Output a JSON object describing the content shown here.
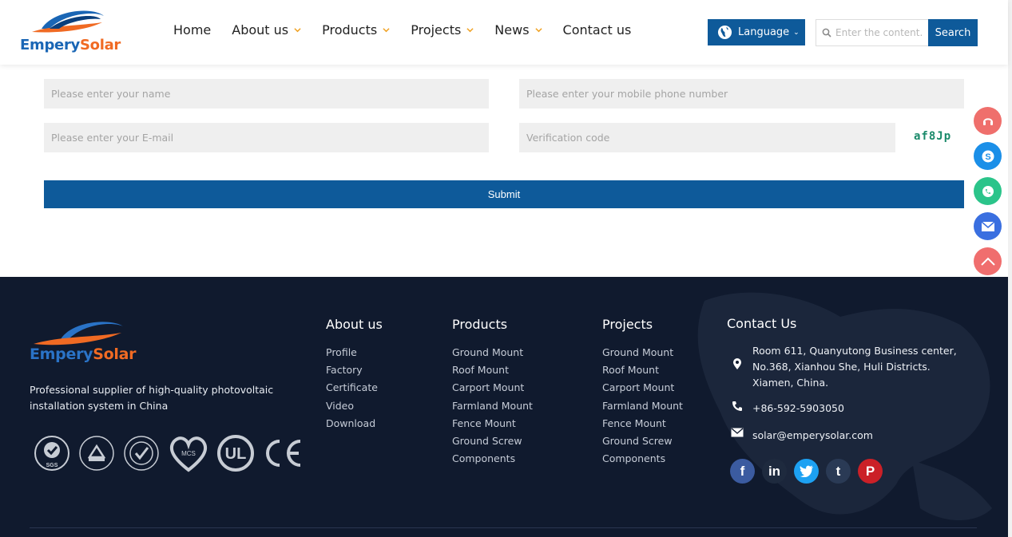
{
  "brand": {
    "part1": "Empery",
    "part2": "Solar"
  },
  "nav": [
    {
      "label": "Home",
      "dropdown": false
    },
    {
      "label": "About us",
      "dropdown": true
    },
    {
      "label": "Products",
      "dropdown": true
    },
    {
      "label": "Projects",
      "dropdown": true
    },
    {
      "label": "News",
      "dropdown": true
    },
    {
      "label": "Contact us",
      "dropdown": false
    }
  ],
  "language": {
    "label": "Language"
  },
  "search": {
    "placeholder": "Enter the content...",
    "button": "Search"
  },
  "form": {
    "name_placeholder": "Please enter your name",
    "phone_placeholder": "Please enter your mobile phone number",
    "email_placeholder": "Please enter your E-mail",
    "code_placeholder": "Verification code",
    "captcha": "af8Jp",
    "submit": "Submit"
  },
  "float_icons": [
    "chat-icon",
    "skype-icon",
    "whatsapp-icon",
    "mail-icon",
    "back-to-top-icon"
  ],
  "footer": {
    "description": "Professional supplier of high-quality photovoltaic installation system in China",
    "about": {
      "title": "About us",
      "items": [
        "Profile",
        "Factory",
        "Certificate",
        "Video",
        "Download"
      ]
    },
    "products": {
      "title": "Products",
      "items": [
        "Ground Mount",
        "Roof Mount",
        "Carport Mount",
        "Farmland Mount",
        "Fence Mount",
        "Ground Screw",
        "Components"
      ]
    },
    "projects": {
      "title": "Projects",
      "items": [
        "Ground Mount",
        "Roof Mount",
        "Carport Mount",
        "Farmland Mount",
        "Fence Mount",
        "Ground Screw",
        "Components"
      ]
    },
    "contact": {
      "title": "Contact Us",
      "address": "Room 611, Quanyutong Business center, No.368, Xianhou She, Huli Districts. Xiamen, China.",
      "phone": "+86-592-5903050",
      "email": "solar@emperysolar.com"
    },
    "certifications": [
      "SGS",
      "TUV Rheinland",
      "Global Certification",
      "MCS",
      "UL",
      "CE"
    ],
    "social": [
      "facebook-icon",
      "linkedin-icon",
      "twitter-icon",
      "tumblr-icon",
      "pinterest-icon"
    ]
  },
  "colors": {
    "primary": "#0e5a9a",
    "accent": "#f06a23",
    "footer_bg": "#101a2e"
  }
}
